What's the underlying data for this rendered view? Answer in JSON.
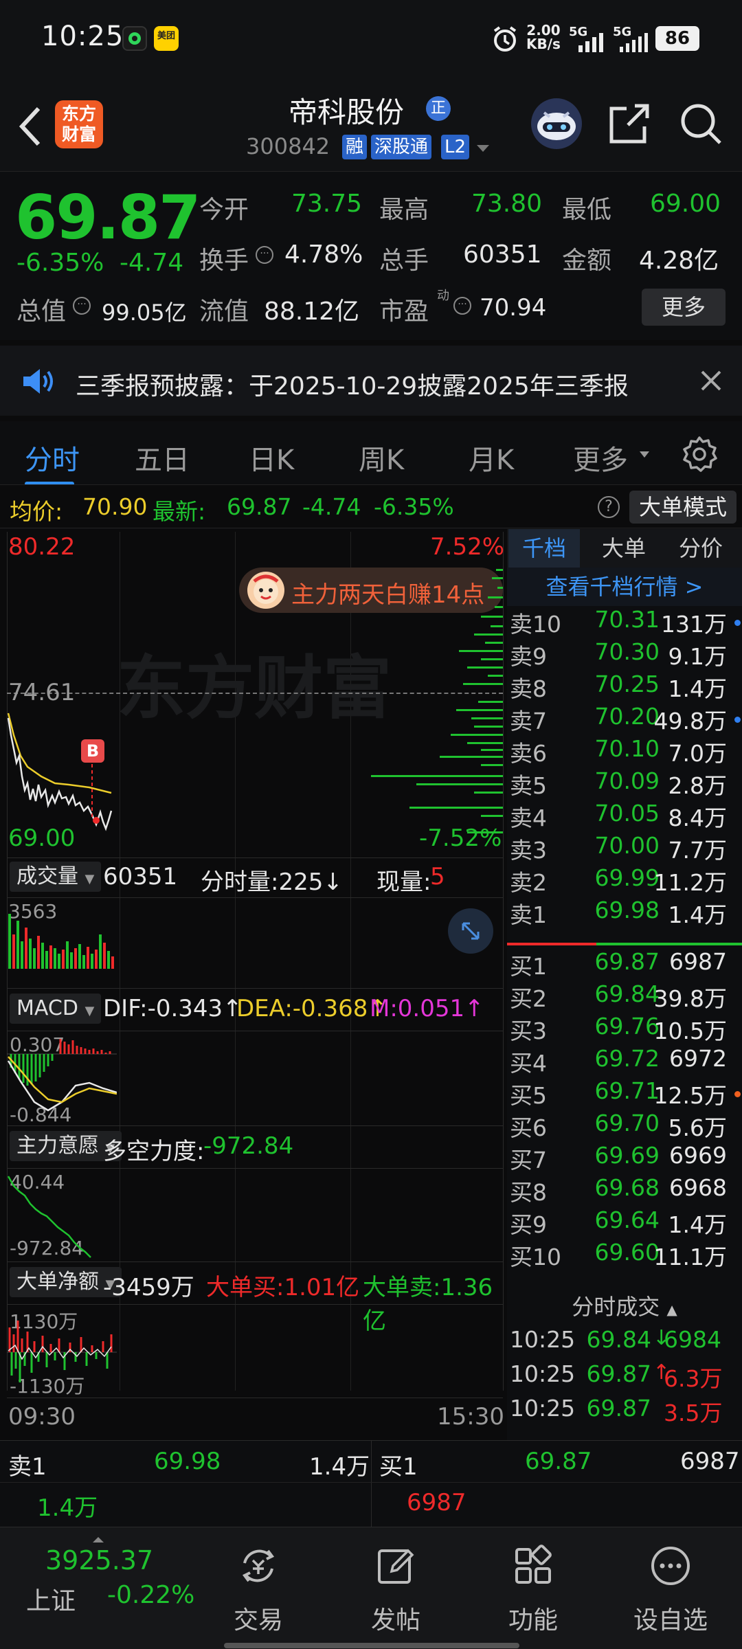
{
  "status": {
    "time": "10:25",
    "net_speed_top": "2.00",
    "net_speed_unit": "KB/s",
    "sig1": "5G",
    "sig2": "5G",
    "battery": "86",
    "app2_label": "美团"
  },
  "header": {
    "title": "帝科股份",
    "title_badge": "正",
    "code": "300842",
    "tags": [
      "融",
      "深股通",
      "L2"
    ]
  },
  "quote": {
    "price": "69.87",
    "change_pct": "-6.35%",
    "change": "-4.74",
    "open_label": "今开",
    "open": "73.75",
    "high_label": "最高",
    "high": "73.80",
    "low_label": "最低",
    "low": "69.00",
    "turnover_label": "换手",
    "turnover": "4.78%",
    "volume_label": "总手",
    "volume": "60351",
    "amount_label": "金额",
    "amount": "4.28亿",
    "mktcap_label": "总值",
    "mktcap": "99.05亿",
    "float_label": "流值",
    "float": "88.12亿",
    "pe_label": "市盈",
    "pe_sup": "动",
    "pe": "70.94",
    "more": "更多"
  },
  "notice": {
    "text": "三季报预披露：于2025-10-29披露2025年三季报"
  },
  "tabs": [
    "分时",
    "五日",
    "日K",
    "周K",
    "月K",
    "更多"
  ],
  "inforow": {
    "avg_label": "均价:",
    "avg": "70.90",
    "last_label": "最新:",
    "last": "69.87",
    "chg": "-4.74",
    "pct": "-6.35%",
    "mode": "大单模式"
  },
  "chart": {
    "ymax": "80.22",
    "ymax_pct": "7.52%",
    "ymid": "74.61",
    "ymin": "69.00",
    "ymin_pct": "-7.52%",
    "promo": "主力两天白赚14点",
    "watermark": "东方财富",
    "marker": "B",
    "vol_label": "成交量",
    "vol_total": "60351",
    "vol_tick_label": "分时量:225↓",
    "vol_now_label": "现量:",
    "vol_now": "5",
    "vol_max": "3563",
    "macd_label": "MACD",
    "dif": "DIF:-0.343↑",
    "dea": "DEA:-0.368↑",
    "m": "M:0.051↑",
    "macd_top": "0.307",
    "macd_bot": "-0.844",
    "main_label": "主力意愿",
    "main_power_label": "多空力度:",
    "main_power": "-972.84",
    "main_top": "40.44",
    "main_bot": "-972.84",
    "big_label": "大单净额",
    "big_net": "-3459万",
    "big_buy": "大单买:1.01亿",
    "big_sell": "大单卖:1.36亿",
    "big_top": "1130万",
    "big_bot": "-1130万",
    "t_start": "09:30",
    "t_end": "15:30"
  },
  "book": {
    "tabs": [
      "千档",
      "大单",
      "分价"
    ],
    "link": "查看千档行情 >",
    "asks": [
      {
        "lv": "卖10",
        "p": "70.31",
        "v": "131万",
        "dot": "#2f7ff0"
      },
      {
        "lv": "卖9",
        "p": "70.30",
        "v": "9.1万",
        "dot": ""
      },
      {
        "lv": "卖8",
        "p": "70.25",
        "v": "1.4万",
        "dot": ""
      },
      {
        "lv": "卖7",
        "p": "70.20",
        "v": "49.8万",
        "dot": "#2f7ff0"
      },
      {
        "lv": "卖6",
        "p": "70.10",
        "v": "7.0万",
        "dot": ""
      },
      {
        "lv": "卖5",
        "p": "70.09",
        "v": "2.8万",
        "dot": ""
      },
      {
        "lv": "卖4",
        "p": "70.05",
        "v": "8.4万",
        "dot": ""
      },
      {
        "lv": "卖3",
        "p": "70.00",
        "v": "7.7万",
        "dot": ""
      },
      {
        "lv": "卖2",
        "p": "69.99",
        "v": "11.2万",
        "dot": ""
      },
      {
        "lv": "卖1",
        "p": "69.98",
        "v": "1.4万",
        "dot": ""
      }
    ],
    "bids": [
      {
        "lv": "买1",
        "p": "69.87",
        "v": "6987",
        "dot": ""
      },
      {
        "lv": "买2",
        "p": "69.84",
        "v": "39.8万",
        "dot": ""
      },
      {
        "lv": "买3",
        "p": "69.76",
        "v": "10.5万",
        "dot": ""
      },
      {
        "lv": "买4",
        "p": "69.72",
        "v": "6972",
        "dot": ""
      },
      {
        "lv": "买5",
        "p": "69.71",
        "v": "12.5万",
        "dot": "#f0601f"
      },
      {
        "lv": "买6",
        "p": "69.70",
        "v": "5.6万",
        "dot": ""
      },
      {
        "lv": "买7",
        "p": "69.69",
        "v": "6969",
        "dot": ""
      },
      {
        "lv": "买8",
        "p": "69.68",
        "v": "6968",
        "dot": ""
      },
      {
        "lv": "买9",
        "p": "69.64",
        "v": "1.4万",
        "dot": ""
      },
      {
        "lv": "买10",
        "p": "69.60",
        "v": "11.1万",
        "dot": ""
      }
    ],
    "ticks_title": "分时成交",
    "ticks": [
      {
        "t": "10:25",
        "p": "69.84",
        "arrow": "↓",
        "v": "6984",
        "vc": "g"
      },
      {
        "t": "10:25",
        "p": "69.87",
        "arrow": "↑",
        "v": "6.3万",
        "vc": "r"
      },
      {
        "t": "10:25",
        "p": "69.87",
        "arrow": "",
        "v": "3.5万",
        "vc": "r"
      }
    ]
  },
  "bottom": {
    "ask_label": "卖1",
    "ask_price": "69.98",
    "ask_vol": "1.4万",
    "ask_sub": "1.4万",
    "bid_label": "买1",
    "bid_price": "69.87",
    "bid_vol": "6987",
    "bid_sub": "6987"
  },
  "nav": {
    "index_value": "3925.37",
    "index_name": "上证",
    "index_pct": "-0.22%",
    "items": [
      "交易",
      "发帖",
      "功能",
      "设自选"
    ]
  },
  "colors": {
    "up": "#ee2a2a",
    "down": "#1fc22f",
    "accent": "#2f8ef0",
    "avg_line": "#eccd2b"
  }
}
